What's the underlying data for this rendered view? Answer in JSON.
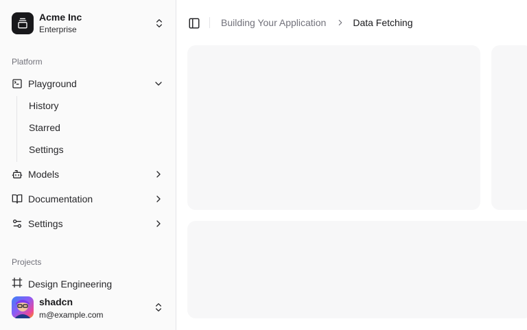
{
  "team": {
    "name": "Acme Inc",
    "plan": "Enterprise"
  },
  "platform": {
    "label": "Platform",
    "items": [
      {
        "label": "Playground",
        "icon": "terminal-icon",
        "expanded": true
      },
      {
        "label": "Models",
        "icon": "bot-icon",
        "expanded": false
      },
      {
        "label": "Documentation",
        "icon": "book-open-icon",
        "expanded": false
      },
      {
        "label": "Settings",
        "icon": "sliders-icon",
        "expanded": false
      }
    ],
    "playground_sub": [
      "History",
      "Starred",
      "Settings"
    ]
  },
  "projects": {
    "label": "Projects",
    "items": [
      {
        "label": "Design Engineering",
        "icon": "frame-icon"
      }
    ]
  },
  "user": {
    "name": "shadcn",
    "email": "m@example.com"
  },
  "breadcrumb": {
    "parent": "Building Your Application",
    "current": "Data Fetching"
  },
  "colors": {
    "sidebar_bg": "#fafafa",
    "border": "#e4e4e7",
    "card_bg": "#f7f7f8",
    "muted_text": "#71717a",
    "primary": "#18181b"
  }
}
